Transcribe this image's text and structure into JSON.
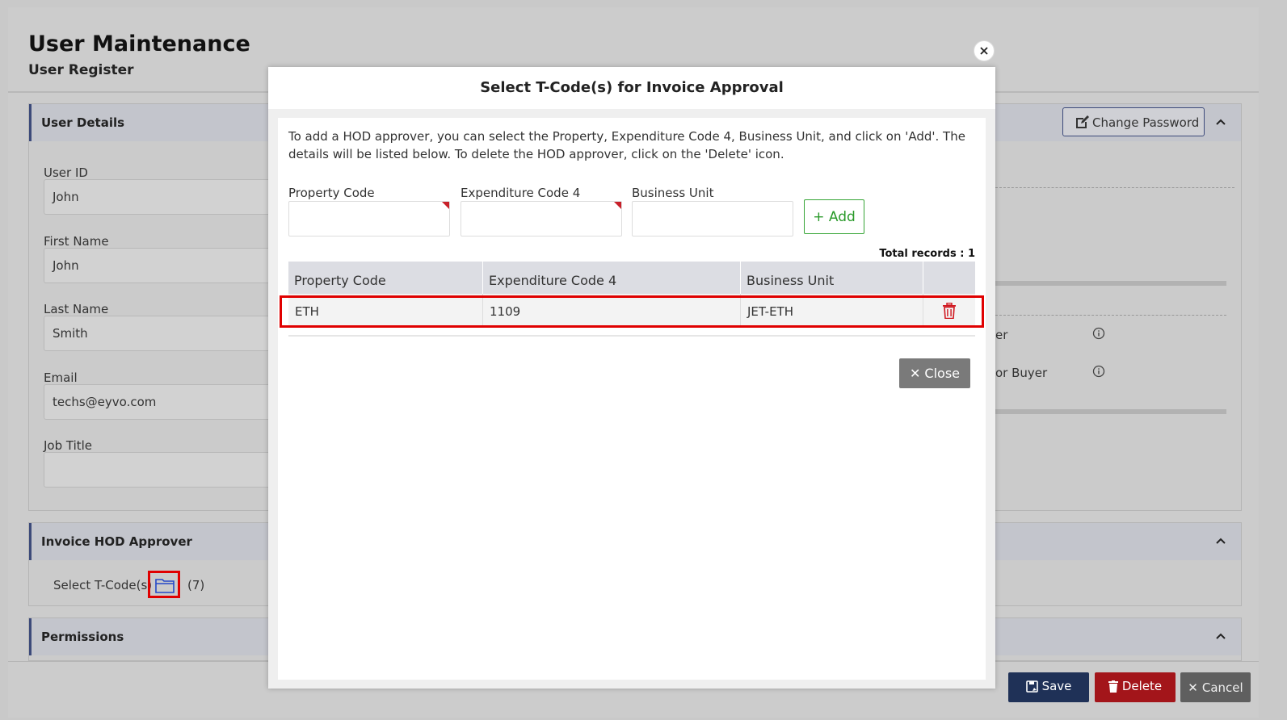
{
  "page": {
    "title": "User Maintenance",
    "subtitle": "User Register"
  },
  "user_details": {
    "header": "User Details",
    "change_password_label": "Change Password",
    "fields": [
      {
        "label": "User ID",
        "value": "John"
      },
      {
        "label": "First Name",
        "value": "John"
      },
      {
        "label": "Last Name",
        "value": "Smith"
      },
      {
        "label": "Email",
        "value": "techs@eyvo.com"
      },
      {
        "label": "Job Title",
        "value": ""
      }
    ],
    "partial_labels": [
      "er",
      "or Buyer"
    ]
  },
  "invoice_hod": {
    "header": "Invoice HOD Approver",
    "select_label": "Select T-Code(s)",
    "count": "(7)"
  },
  "permissions": {
    "header": "Permissions"
  },
  "footer": {
    "save_label": "Save",
    "delete_label": "Delete",
    "cancel_label": "Cancel"
  },
  "modal": {
    "title": "Select T-Code(s) for Invoice Approval",
    "instructions": "To add a HOD approver, you can select the Property, Expenditure Code 4, Business Unit, and click on 'Add'. The details will be listed below. To delete the HOD approver, click on the 'Delete' icon.",
    "property_label": "Property Code",
    "expenditure_label": "Expenditure Code 4",
    "business_unit_label": "Business Unit",
    "property_value": "",
    "expenditure_value": "",
    "business_unit_value": "",
    "add_label": "+ Add",
    "total_records": "Total records : 1",
    "columns": [
      "Property Code",
      "Expenditure Code 4",
      "Business Unit"
    ],
    "rows": [
      {
        "property": "ETH",
        "expenditure": "1109",
        "business_unit": "JET-ETH"
      }
    ],
    "close_label": "Close"
  },
  "colors": {
    "accent_navy": "#1f3157",
    "delete_red": "#a3151a",
    "add_green": "#2a9a2a",
    "highlight_red": "#e00000"
  }
}
